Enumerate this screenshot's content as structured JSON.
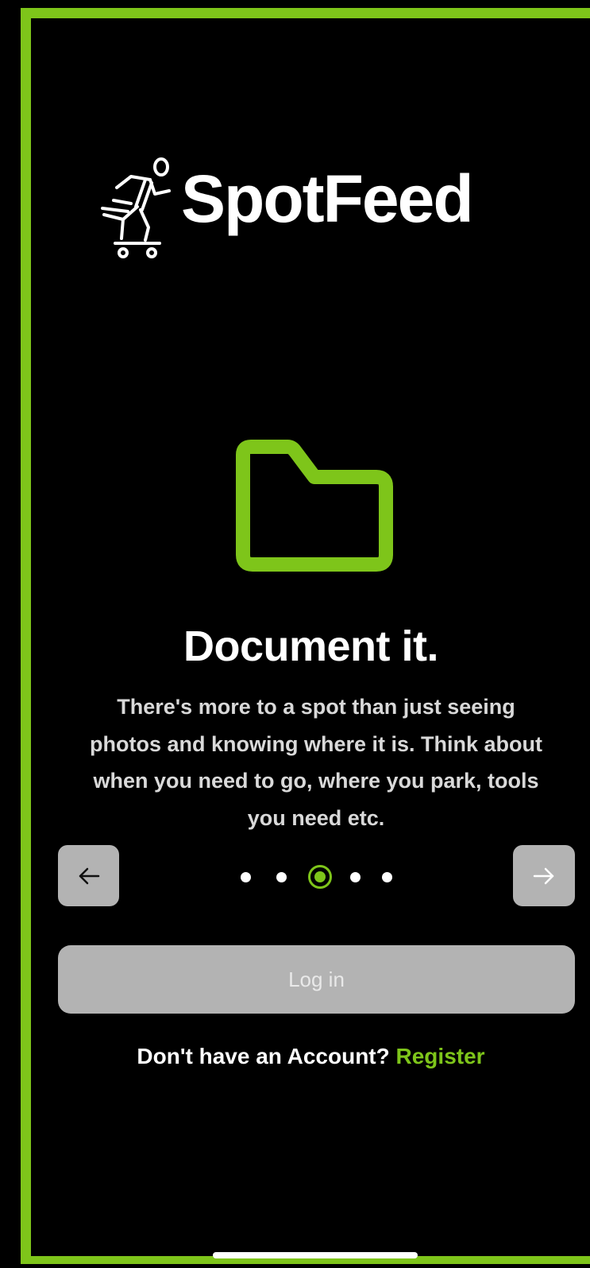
{
  "app": {
    "logo_text": "SpotFeed"
  },
  "onboarding": {
    "icon": "folder-icon",
    "title": "Document it.",
    "description": "There's more to a spot than just seeing photos and knowing where it is.  Think about when you need to go, where you park, tools you need etc.",
    "page_indicator": {
      "total": 5,
      "current": 3
    }
  },
  "nav": {
    "prev_icon": "arrow-left-icon",
    "next_icon": "arrow-right-icon"
  },
  "auth": {
    "login_label": "Log in",
    "register_prompt": "Don't have an Account?",
    "register_link": "Register"
  },
  "colors": {
    "accent": "#7ec51a",
    "background": "#000000",
    "button_gray": "#b3b3b3"
  }
}
